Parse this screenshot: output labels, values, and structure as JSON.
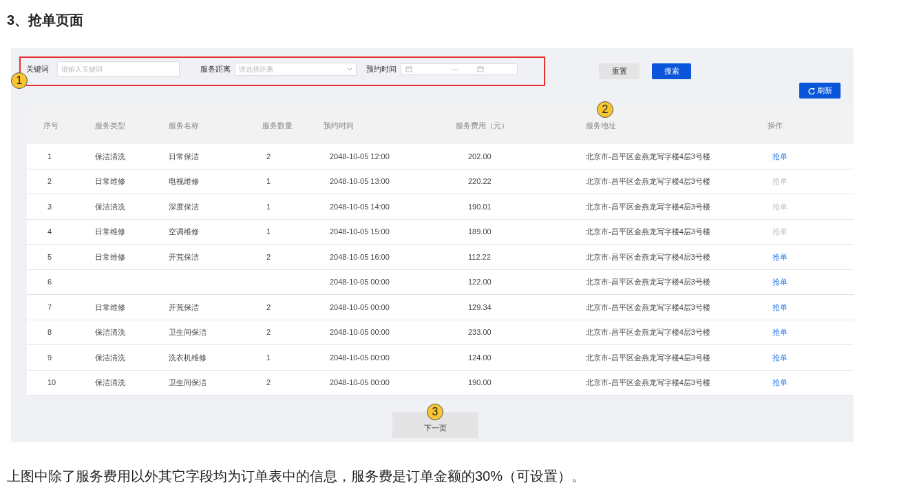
{
  "heading": "3、抢单页面",
  "filters": {
    "keyword": {
      "label": "关键词",
      "placeholder": "请输入关键词"
    },
    "distance": {
      "label": "服务距离",
      "placeholder": "请选择距离"
    },
    "time": {
      "label": "预约时间",
      "separator": "—"
    }
  },
  "buttons": {
    "reset": "重置",
    "search": "搜索",
    "refresh": "刷新"
  },
  "callouts": [
    "1",
    "2",
    "3"
  ],
  "table": {
    "columns": [
      "序号",
      "服务类型",
      "服务名称",
      "服务数量",
      "预约时间",
      "服务费用（元）",
      "服务地址",
      "操作"
    ],
    "rows": [
      {
        "cells": [
          "1",
          "保洁清洗",
          "日常保洁",
          "2",
          "2048-10-05 12:00",
          "202.00",
          "北京市-昌平区金燕龙写字楼4层3号楼"
        ],
        "action": "抢单",
        "disabled": false
      },
      {
        "cells": [
          "2",
          "日常维修",
          "电视维修",
          "1",
          "2048-10-05 13:00",
          "220.22",
          "北京市-昌平区金燕龙写字楼4层3号楼"
        ],
        "action": "抢单",
        "disabled": true
      },
      {
        "cells": [
          "3",
          "保洁清洗",
          "深度保洁",
          "1",
          "2048-10-05 14:00",
          "190.01",
          "北京市-昌平区金燕龙写字楼4层3号楼"
        ],
        "action": "抢单",
        "disabled": true
      },
      {
        "cells": [
          "4",
          "日常维修",
          "空调维修",
          "1",
          "2048-10-05 15:00",
          "189.00",
          "北京市-昌平区金燕龙写字楼4层3号楼"
        ],
        "action": "抢单",
        "disabled": true
      },
      {
        "cells": [
          "5",
          "日常维修",
          "开荒保洁",
          "2",
          "2048-10-05 16:00",
          "112.22",
          "北京市-昌平区金燕龙写字楼4层3号楼"
        ],
        "action": "抢单",
        "disabled": false
      },
      {
        "cells": [
          "6",
          "",
          "",
          "",
          "2048-10-05 00:00",
          "122.00",
          "北京市-昌平区金燕龙写字楼4层3号楼"
        ],
        "action": "抢单",
        "disabled": false
      },
      {
        "cells": [
          "7",
          "日常维修",
          "开荒保洁",
          "2",
          "2048-10-05 00:00",
          "129.34",
          "北京市-昌平区金燕龙写字楼4层3号楼"
        ],
        "action": "抢单",
        "disabled": false
      },
      {
        "cells": [
          "8",
          "保洁清洗",
          "卫生间保洁",
          "2",
          "2048-10-05 00:00",
          "233.00",
          "北京市-昌平区金燕龙写字楼4层3号楼"
        ],
        "action": "抢单",
        "disabled": false
      },
      {
        "cells": [
          "9",
          "保洁清洗",
          "洗衣机维修",
          "1",
          "2048-10-05 00:00",
          "124.00",
          "北京市-昌平区金燕龙写字楼4层3号楼"
        ],
        "action": "抢单",
        "disabled": false
      },
      {
        "cells": [
          "10",
          "保洁清洗",
          "卫生间保洁",
          "2",
          "2048-10-05 00:00",
          "190.00",
          "北京市-昌平区金燕龙写字楼4层3号楼"
        ],
        "action": "抢单",
        "disabled": false
      }
    ]
  },
  "pagination": {
    "next": "下一页"
  },
  "caption": "上图中除了服务费用以外其它字段均为订单表中的信息，服务费是订单金额的30%（可设置）。"
}
